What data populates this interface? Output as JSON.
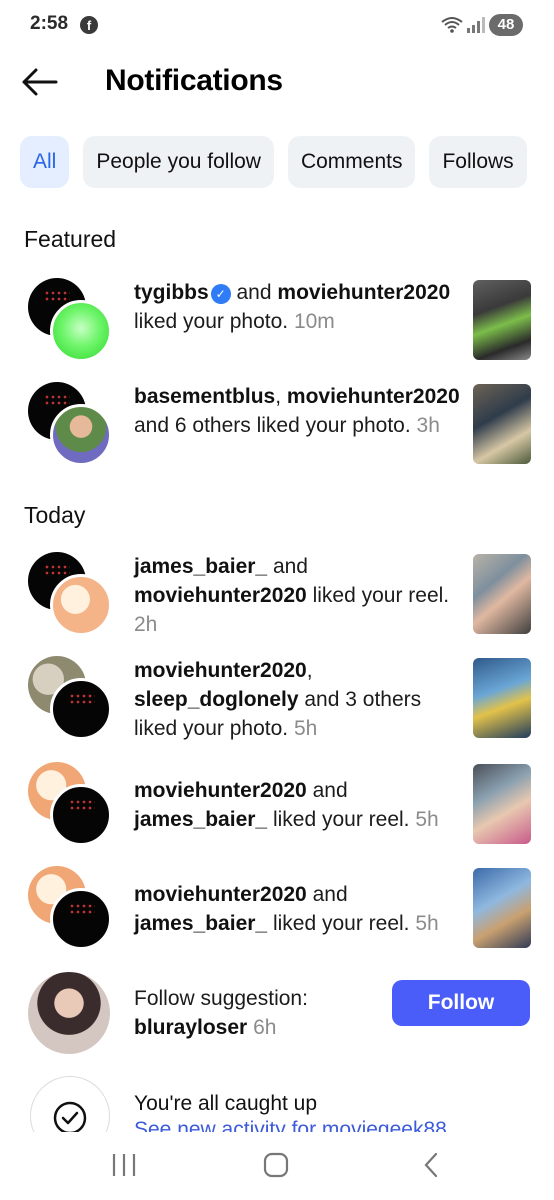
{
  "status_bar": {
    "time": "2:58",
    "battery": "48"
  },
  "header": {
    "title": "Notifications"
  },
  "tabs": [
    {
      "label": "All",
      "active": true
    },
    {
      "label": "People you follow",
      "active": false
    },
    {
      "label": "Comments",
      "active": false
    },
    {
      "label": "Follows",
      "active": false
    }
  ],
  "sections": {
    "featured": "Featured",
    "today": "Today"
  },
  "notifications": [
    {
      "user1": "tygibbs",
      "connector": " and ",
      "user2": "moviehunter2020",
      "action": " liked your photo.",
      "time": "10m"
    },
    {
      "user1": "basementblus",
      "connector": ", ",
      "user2": "moviehunter2020",
      "action": " and 6 others liked your photo.",
      "time": "3h"
    },
    {
      "user1": "james_baier_",
      "connector": " and ",
      "user2": "moviehunter2020",
      "action": " liked your reel.",
      "time": "2h"
    },
    {
      "user1": "moviehunter2020",
      "connector": ", ",
      "user2": "sleep_doglonely",
      "action": " and 3 others liked your photo.",
      "time": "5h"
    },
    {
      "user1": "moviehunter2020",
      "connector": " and ",
      "user2": "james_baier_",
      "action": " liked your reel.",
      "time": "5h"
    },
    {
      "user1": "moviehunter2020",
      "connector": " and ",
      "user2": "james_baier_",
      "action": " liked your reel.",
      "time": "5h"
    }
  ],
  "suggestion": {
    "prefix": "Follow suggestion:",
    "user": "blurayloser",
    "time": "6h",
    "button": "Follow"
  },
  "caught_up": {
    "title": "You're all caught up",
    "link": "See new activity for moviegeek88"
  }
}
